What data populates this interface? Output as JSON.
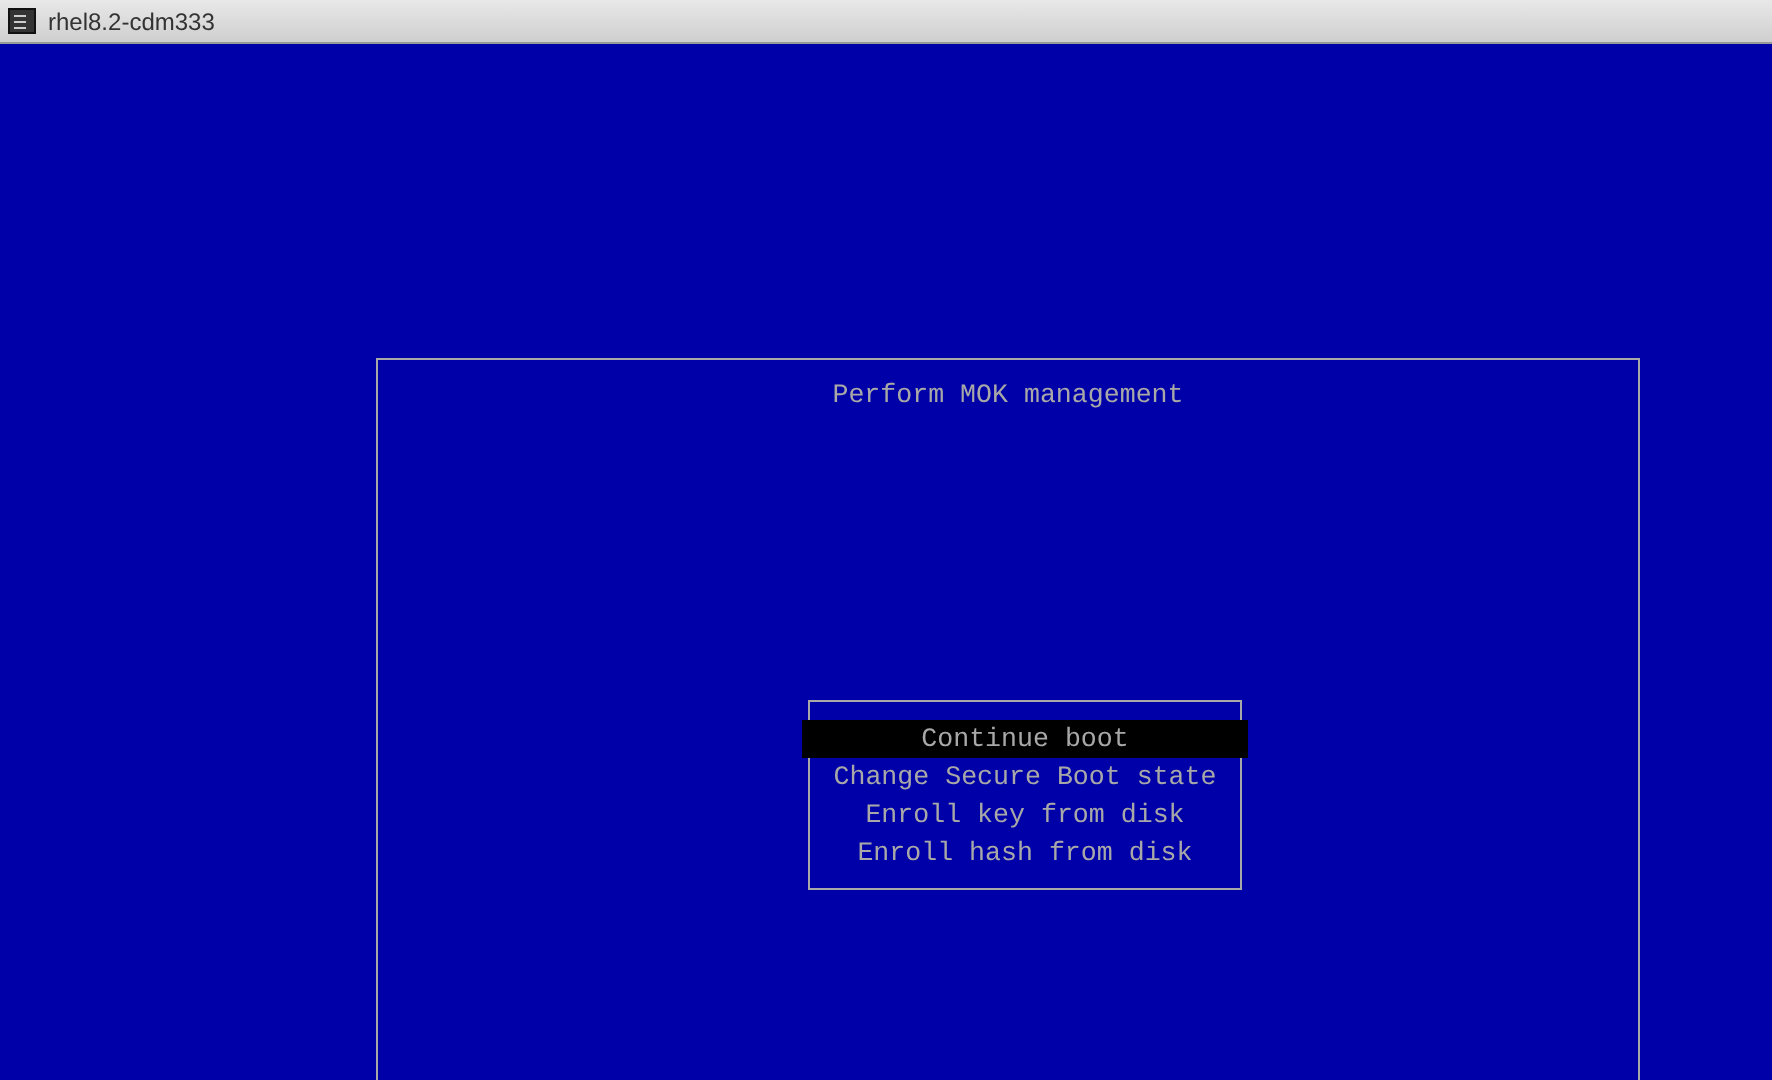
{
  "window": {
    "title": "rhel8.2-cdm333"
  },
  "dialog": {
    "title": "Perform MOK management",
    "menu": [
      {
        "label": "Continue boot",
        "selected": true
      },
      {
        "label": "Change Secure Boot state",
        "selected": false
      },
      {
        "label": "Enroll key from disk",
        "selected": false
      },
      {
        "label": "Enroll hash from disk",
        "selected": false
      }
    ]
  }
}
